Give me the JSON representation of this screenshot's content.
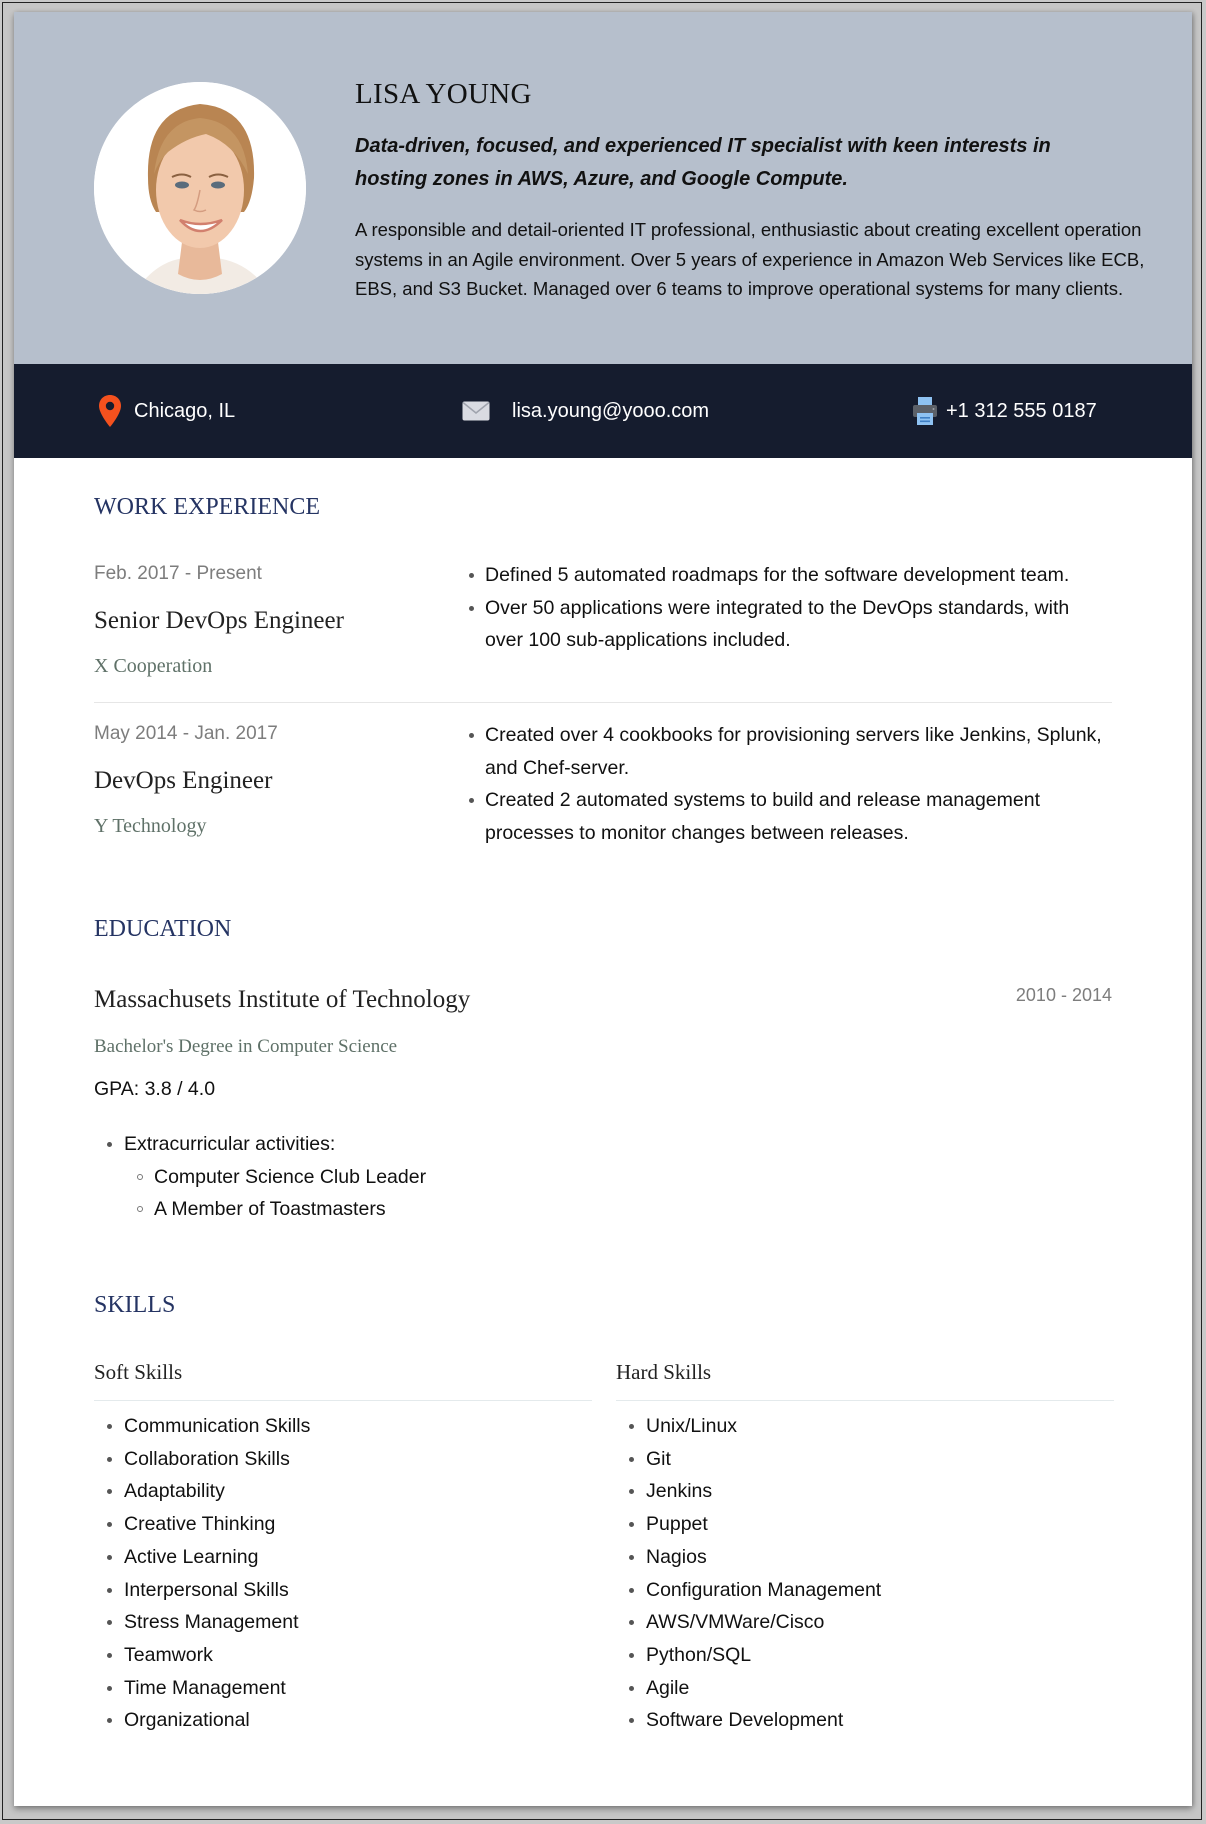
{
  "profile": {
    "name": "LISA YOUNG",
    "tagline": "Data-driven, focused, and experienced IT specialist with keen interests in hosting zones in AWS, Azure, and Google Compute.",
    "summary": "A responsible and detail-oriented IT professional, enthusiastic about creating excellent operation systems in an Agile environment. Over 5 years of experience in Amazon Web Services like ECB, EBS, and S3 Bucket. Managed over 6 teams to improve operational systems for many clients.",
    "photo_icon": "profile-photo"
  },
  "contact": {
    "location": {
      "icon": "map-pin-icon",
      "text": "Chicago, IL"
    },
    "email": {
      "icon": "envelope-icon",
      "text": "lisa.young@yooo.com"
    },
    "phone": {
      "icon": "printer-icon",
      "text": "+1 312 555 0187"
    }
  },
  "colors": {
    "header_bg": "#b6bfcc",
    "contact_bar_bg": "#151c2e",
    "section_title": "#253463",
    "pin": "#f4511e"
  },
  "work": {
    "title": "WORK EXPERIENCE",
    "jobs": [
      {
        "dates": "Feb. 2017 - Present",
        "title": "Senior DevOps Engineer",
        "company": "X Cooperation",
        "bullets": [
          "Defined 5 automated roadmaps for the software development team.",
          "Over 50 applications were integrated to the DevOps standards, with over 100 sub-applications included."
        ]
      },
      {
        "dates": "May 2014 - Jan. 2017",
        "title": "DevOps Engineer",
        "company": "Y Technology",
        "bullets": [
          "Created over 4 cookbooks for provisioning servers like Jenkins, Splunk, and Chef-server.",
          "Created 2 automated systems to build and release management processes to monitor changes between releases."
        ]
      }
    ]
  },
  "education": {
    "title": "EDUCATION",
    "school": "Massachusets Institute of Technology",
    "years": "2010 - 2014",
    "degree": "Bachelor's Degree in Computer Science",
    "gpa": "GPA: 3.8 / 4.0",
    "extracurricular_label": "Extracurricular activities:",
    "extracurricular": [
      "Computer Science Club Leader",
      "A Member of Toastmasters"
    ]
  },
  "skills": {
    "title": "SKILLS",
    "soft": {
      "heading": "Soft Skills",
      "items": [
        "Communication Skills",
        "Collaboration Skills",
        "Adaptability",
        "Creative Thinking",
        "Active Learning",
        "Interpersonal Skills",
        "Stress Management",
        "Teamwork",
        "Time Management",
        "Organizational"
      ]
    },
    "hard": {
      "heading": "Hard Skills",
      "items": [
        "Unix/Linux",
        "Git",
        "Jenkins",
        "Puppet",
        "Nagios",
        "Configuration Management",
        "AWS/VMWare/Cisco",
        "Python/SQL",
        "Agile",
        "Software Development"
      ]
    }
  }
}
